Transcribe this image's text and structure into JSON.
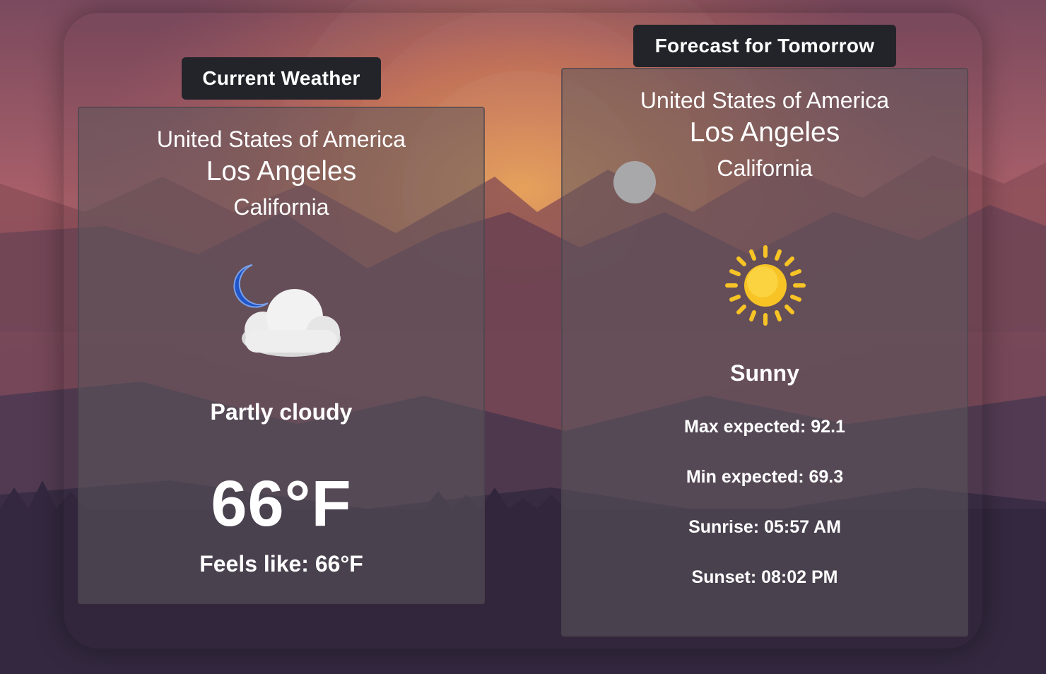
{
  "colors": {
    "sky_top": "#9c5a6a",
    "sky_glow": "#e8884a",
    "tag_bg": "#23242a",
    "card_bg": "#5c585c",
    "sun": "#f7c325",
    "moon": "#1f55c8",
    "text": "#ffffff"
  },
  "current": {
    "heading": "Current Weather",
    "country": "United States of America",
    "city": "Los Angeles",
    "region": "California",
    "icon": "moon-cloud-icon",
    "condition": "Partly cloudy",
    "temperature": "66°F",
    "feels_like": "Feels like: 66°F"
  },
  "forecast": {
    "heading": "Forecast for Tomorrow",
    "country": "United States of America",
    "city": "Los Angeles",
    "region": "California",
    "icon": "sun-icon",
    "condition": "Sunny",
    "max": "Max expected: 92.1",
    "min": "Min expected: 69.3",
    "sunrise": "Sunrise: 05:57 AM",
    "sunset": "Sunset: 08:02 PM"
  }
}
